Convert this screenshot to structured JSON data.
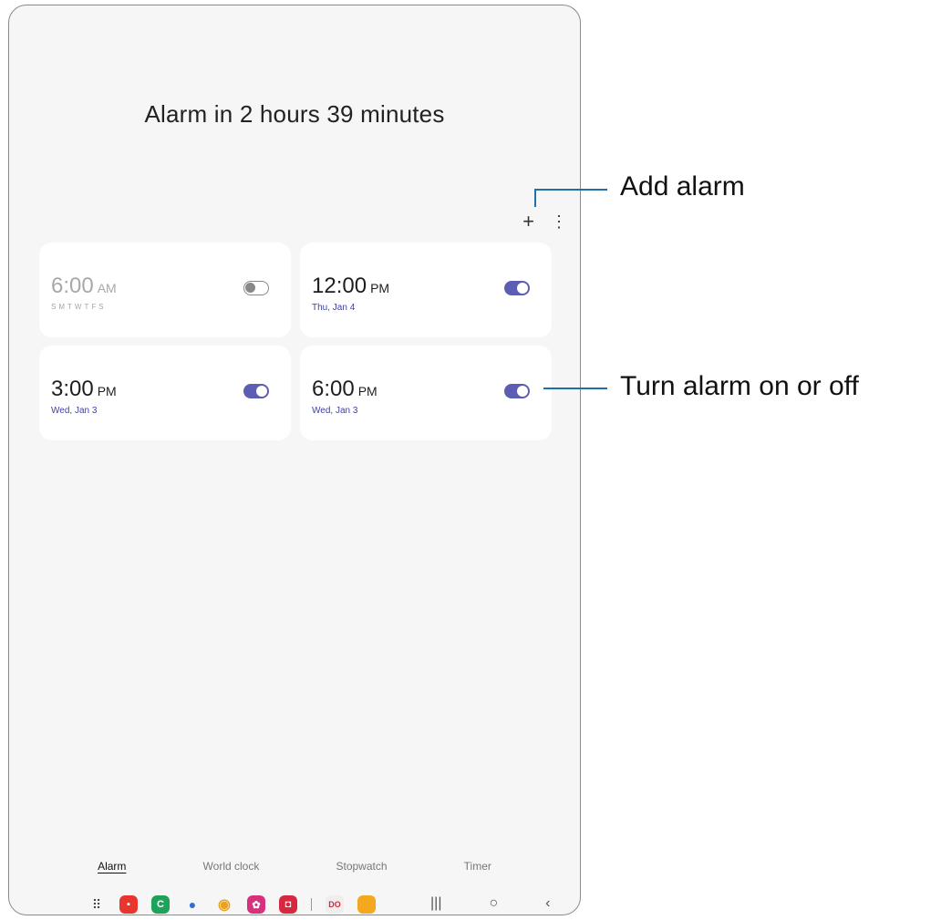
{
  "header": {
    "alarm_summary": "Alarm in 2 hours 39 minutes"
  },
  "toolbar": {
    "add_glyph": "+",
    "more_glyph": "⋮"
  },
  "alarms": [
    {
      "time": "6:00",
      "ampm": "AM",
      "days": "SMTWTFS",
      "enabled": false
    },
    {
      "time": "12:00",
      "ampm": "PM",
      "date": "Thu, Jan 4",
      "enabled": true
    },
    {
      "time": "3:00",
      "ampm": "PM",
      "date": "Wed, Jan 3",
      "enabled": true
    },
    {
      "time": "6:00",
      "ampm": "PM",
      "date": "Wed, Jan 3",
      "enabled": true
    }
  ],
  "tabs": [
    {
      "label": "Alarm",
      "active": true
    },
    {
      "label": "World clock"
    },
    {
      "label": "Stopwatch"
    },
    {
      "label": "Timer"
    }
  ],
  "dock": {
    "apps_grid": "⠿",
    "apps": [
      {
        "icon": "notes-icon",
        "color": "#e8362f",
        "glyph": "▪"
      },
      {
        "icon": "phone-icon",
        "color": "#1fa35a",
        "glyph": "C"
      },
      {
        "icon": "messages-icon",
        "color": "#2f6fd6",
        "glyph": "●"
      },
      {
        "icon": "chrome-icon",
        "color": "#e9a31e",
        "glyph": "◉"
      },
      {
        "icon": "gallery-icon",
        "color": "#d7317e",
        "glyph": "✿"
      },
      {
        "icon": "camera-icon",
        "color": "#d8283f",
        "glyph": "◘"
      },
      {
        "icon": "dual-apps-icon",
        "color": "#e0e0e0",
        "glyph": "DO"
      },
      {
        "icon": "folder-icon",
        "color": "#f3a81f",
        "glyph": "▭"
      }
    ]
  },
  "nav": {
    "recents": "|||",
    "home": "○",
    "back": "‹"
  },
  "callouts": {
    "add_alarm": "Add alarm",
    "toggle_alarm": "Turn alarm on or off"
  }
}
